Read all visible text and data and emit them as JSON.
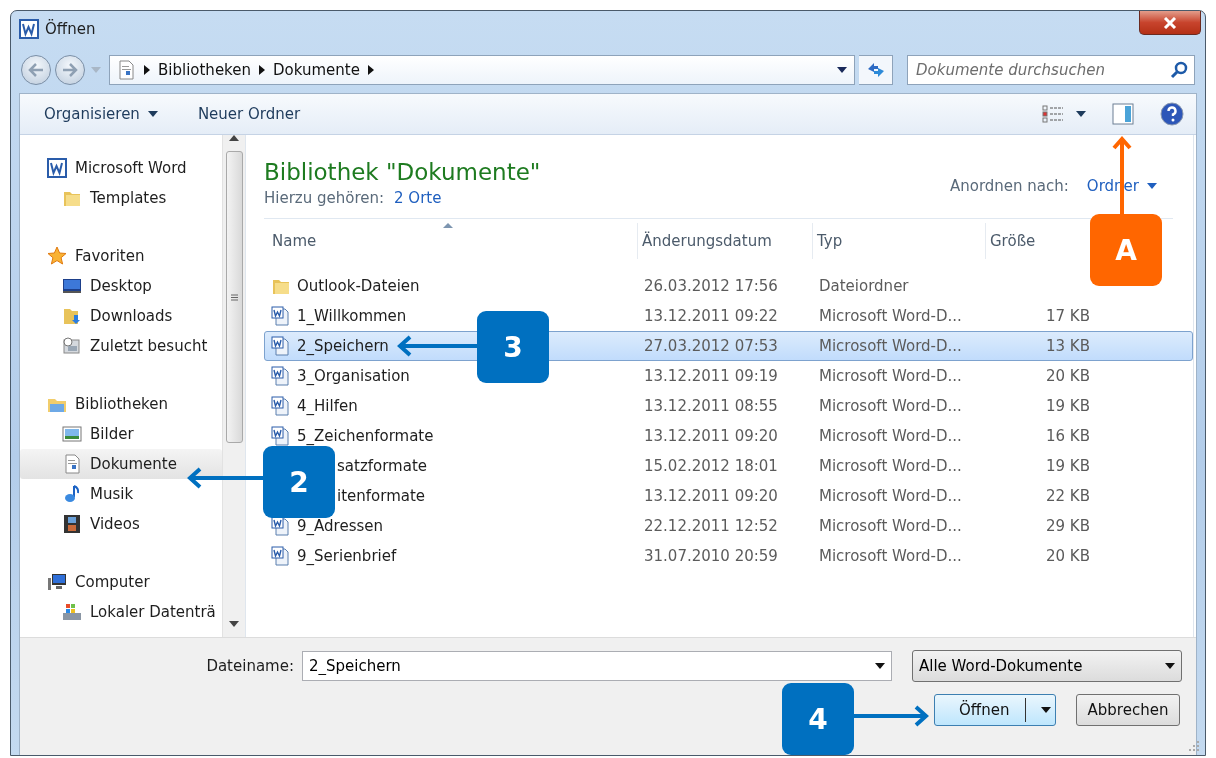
{
  "window": {
    "title": "Öffnen"
  },
  "address_bar": {
    "path": [
      "Bibliotheken",
      "Dokumente"
    ]
  },
  "search": {
    "placeholder": "Dokumente durchsuchen"
  },
  "toolbar": {
    "buttons": [
      {
        "label": "Organisieren",
        "dropdown": true
      },
      {
        "label": "Neuer Ordner",
        "dropdown": false
      }
    ]
  },
  "sidebar": {
    "groups": [
      {
        "label": "Microsoft Word",
        "kind": "word",
        "children": [
          {
            "label": "Templates",
            "kind": "folder",
            "selected": false
          }
        ]
      },
      {
        "label": "Favoriten",
        "kind": "star",
        "children": [
          {
            "label": "Desktop",
            "kind": "desktop",
            "selected": false
          },
          {
            "label": "Downloads",
            "kind": "downloads",
            "selected": false
          },
          {
            "label": "Zuletzt besucht",
            "kind": "recent",
            "selected": false
          }
        ]
      },
      {
        "label": "Bibliotheken",
        "kind": "library",
        "children": [
          {
            "label": "Bilder",
            "kind": "pictures",
            "selected": false
          },
          {
            "label": "Dokumente",
            "kind": "document",
            "selected": true
          },
          {
            "label": "Musik",
            "kind": "music",
            "selected": false
          },
          {
            "label": "Videos",
            "kind": "video",
            "selected": false
          }
        ]
      },
      {
        "label": "Computer",
        "kind": "computer",
        "children": [
          {
            "label": "Lokaler Datenträ",
            "kind": "drive",
            "selected": false
          }
        ]
      }
    ]
  },
  "library": {
    "title": "Bibliothek \"Dokumente\"",
    "subtitle": "Hierzu gehören:",
    "locations": "2 Orte",
    "arrange_label": "Anordnen nach:",
    "arrange_value": "Ordner"
  },
  "table": {
    "columns": [
      "Name",
      "Änderungsdatum",
      "Typ",
      "Größe"
    ],
    "rows": [
      {
        "kind": "folder",
        "name": "Outlook-Dateien",
        "date": "26.03.2012 17:56",
        "type": "Dateiordner",
        "size": "",
        "selected": false
      },
      {
        "kind": "doc",
        "name": "1_Willkommen",
        "date": "13.12.2011 09:22",
        "type": "Microsoft Word-D...",
        "size": "17 KB",
        "selected": false
      },
      {
        "kind": "doc",
        "name": "2_Speichern",
        "date": "27.03.2012 07:53",
        "type": "Microsoft Word-D...",
        "size": "13 KB",
        "selected": true
      },
      {
        "kind": "doc",
        "name": "3_Organisation",
        "date": "13.12.2011 09:19",
        "type": "Microsoft Word-D...",
        "size": "20 KB",
        "selected": false
      },
      {
        "kind": "doc",
        "name": "4_Hilfen",
        "date": "13.12.2011 08:55",
        "type": "Microsoft Word-D...",
        "size": "19 KB",
        "selected": false
      },
      {
        "kind": "doc",
        "name": "5_Zeichenformate",
        "date": "13.12.2011 09:20",
        "type": "Microsoft Word-D...",
        "size": "16 KB",
        "selected": false
      },
      {
        "kind": "covered",
        "name": "satzformate",
        "date": "15.02.2012 18:01",
        "type": "Microsoft Word-D...",
        "size": "19 KB",
        "selected": false
      },
      {
        "kind": "covered",
        "name": "itenformate",
        "date": "13.12.2011 09:20",
        "type": "Microsoft Word-D...",
        "size": "22 KB",
        "selected": false
      },
      {
        "kind": "doc",
        "name": "9_Adressen",
        "date": "22.12.2011 12:52",
        "type": "Microsoft Word-D...",
        "size": "29 KB",
        "selected": false
      },
      {
        "kind": "doc",
        "name": "9_Serienbrief",
        "date": "31.07.2010 20:59",
        "type": "Microsoft Word-D...",
        "size": "20 KB",
        "selected": false
      }
    ]
  },
  "footer": {
    "filename_label": "Dateiname:",
    "filename_value": "2_Speichern",
    "filter": "Alle Word-Dokumente",
    "buttons": [
      {
        "label": "Öffnen",
        "kind": "split",
        "default": true
      },
      {
        "label": "Abbrechen",
        "kind": "plain",
        "default": false
      }
    ]
  },
  "callouts": [
    {
      "label": "A",
      "color": "#ff6600"
    },
    {
      "label": "3",
      "color": "#0070c0"
    },
    {
      "label": "2",
      "color": "#0070c0"
    },
    {
      "label": "4",
      "color": "#0070c0"
    }
  ]
}
